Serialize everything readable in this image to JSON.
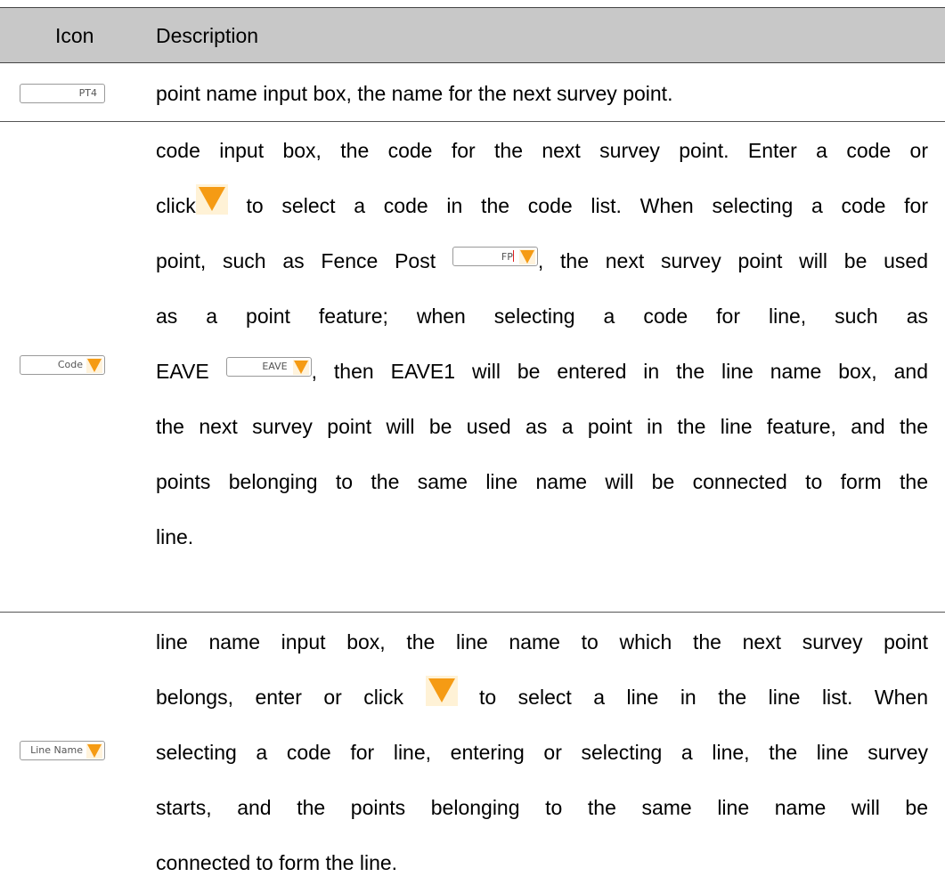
{
  "header": {
    "icon_label": "Icon",
    "description_label": "Description"
  },
  "rows": [
    {
      "icon_value": "PT4",
      "lines": [
        "point name input box, the name for the next survey point."
      ]
    },
    {
      "icon_value": "Code",
      "lines": [
        "code input box, the code for the next survey point. Enter a code or",
        "click",
        "to select a code in the code list. When selecting a code for",
        "point, such as Fence Post",
        ", the next survey point will be used",
        "as a point feature; when selecting a code for line, such as",
        "EAVE",
        ", then EAVE1 will be entered in the line name box, and",
        "the next survey point will be used as a point in the line feature, and the",
        "points belonging to the same line name will be connected to form the",
        "line."
      ],
      "inline_fp_value": "FP",
      "inline_eave_value": "EAVE"
    },
    {
      "icon_value": "Line Name",
      "lines": [
        "line name input box, the line name to which the next survey point",
        "belongs, enter or click",
        "to select a line in the line list. When",
        "selecting a code for line, entering or selecting a line, the line survey",
        "starts, and the points belonging to the same line name will be",
        "connected to form the line."
      ]
    }
  ],
  "colors": {
    "header_bg": "#c8c8c8",
    "dropdown_arrow": "#f59b14"
  },
  "icons": [
    "dropdown-arrow-icon"
  ]
}
